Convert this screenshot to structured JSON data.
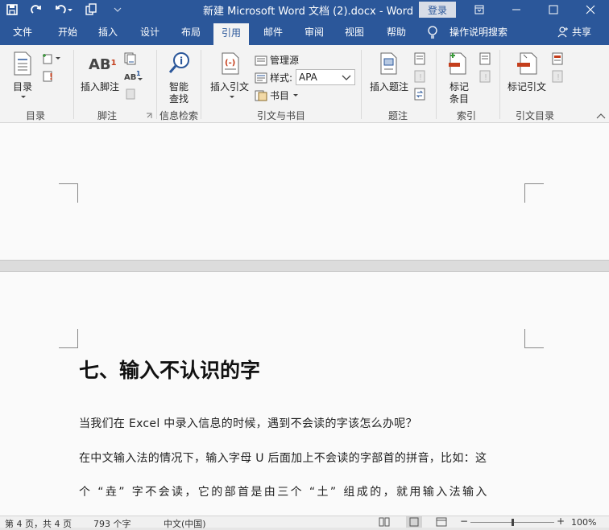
{
  "window": {
    "title": "新建 Microsoft Word 文档 (2).docx - Word",
    "login_label": "登录"
  },
  "tabs": [
    {
      "label": "文件"
    },
    {
      "label": "开始"
    },
    {
      "label": "插入"
    },
    {
      "label": "设计"
    },
    {
      "label": "布局"
    },
    {
      "label": "引用"
    },
    {
      "label": "邮件"
    },
    {
      "label": "审阅"
    },
    {
      "label": "视图"
    },
    {
      "label": "帮助"
    }
  ],
  "tell_me": "操作说明搜索",
  "share": "共享",
  "ribbon": {
    "toc": {
      "button": "目录",
      "group": "目录"
    },
    "footnotes": {
      "button": "插入脚注",
      "group": "脚注",
      "ab_text": "AB"
    },
    "research": {
      "button_line1": "智能",
      "button_line2": "查找",
      "group": "信息检索"
    },
    "citations": {
      "insert_citation": "插入引文",
      "manage_sources": "管理源",
      "style_label": "样式:",
      "style_value": "APA",
      "bibliography": "书目",
      "group": "引文与书目"
    },
    "captions": {
      "button": "插入题注",
      "group": "题注"
    },
    "index": {
      "button_line1": "标记",
      "button_line2": "条目",
      "group": "索引"
    },
    "toa": {
      "button": "标记引文",
      "group": "引文目录"
    }
  },
  "document": {
    "heading": "七、输入不认识的字",
    "paragraphs": [
      "当我们在 Excel 中录入信息的时候，遇到不会读的字该怎么办呢？",
      "在中文输入法的情况下，输入字母 U 后面加上不会读的字部首的拼音，比如：这",
      "个 “垚” 字不会读，它的部首是由三个 “土” 组成的，就用输入法输入"
    ]
  },
  "status": {
    "page": "第 4 页，共 4 页",
    "words": "793 个字",
    "language": "中文(中国)",
    "zoom": "100%"
  },
  "colors": {
    "accent": "#2b579a",
    "ribbon_bg": "#f3f3f3",
    "page_bg": "#fafafa",
    "icon_red": "#c43e1c",
    "icon_green": "#3a9a3a"
  }
}
